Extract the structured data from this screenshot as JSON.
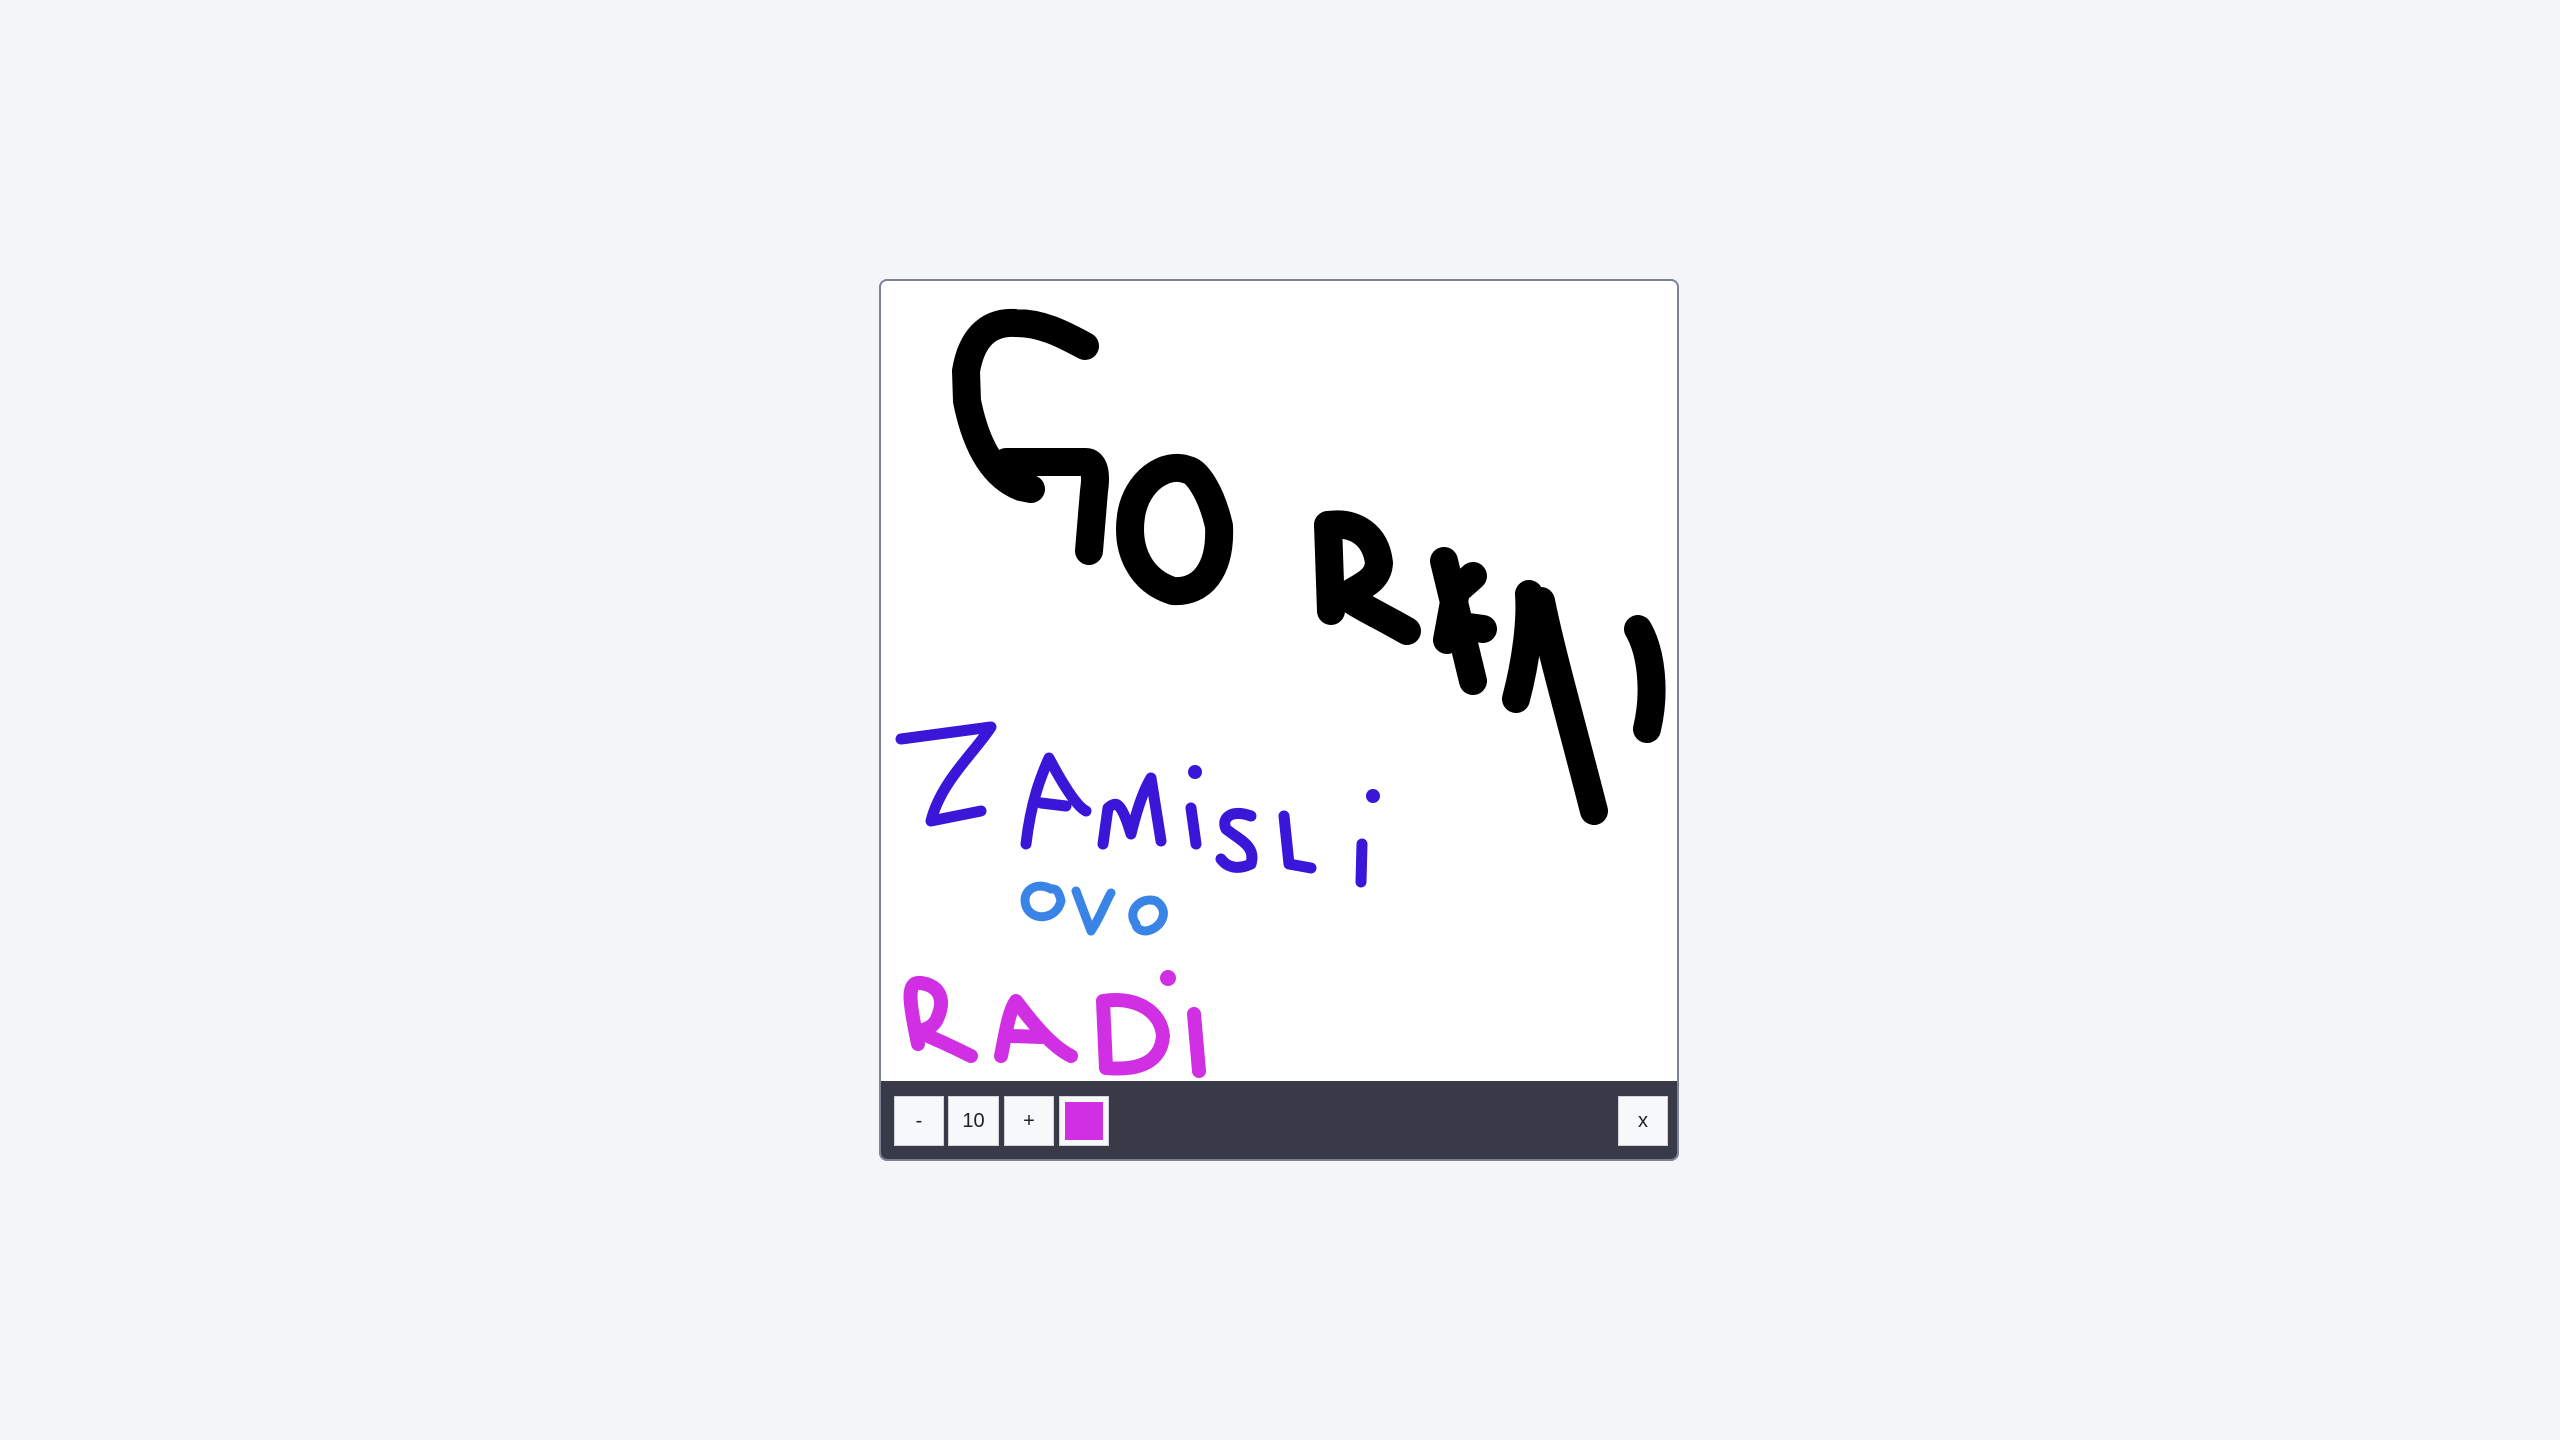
{
  "toolbar": {
    "decrease_label": "-",
    "brush_size": "10",
    "increase_label": "+",
    "current_color": "#d12fe3",
    "close_label": "x"
  },
  "drawing": {
    "stroke_colors": {
      "black": "#000000",
      "indigo": "#3a16d8",
      "sky_blue": "#3a84e6",
      "magenta": "#d12fe3"
    }
  }
}
